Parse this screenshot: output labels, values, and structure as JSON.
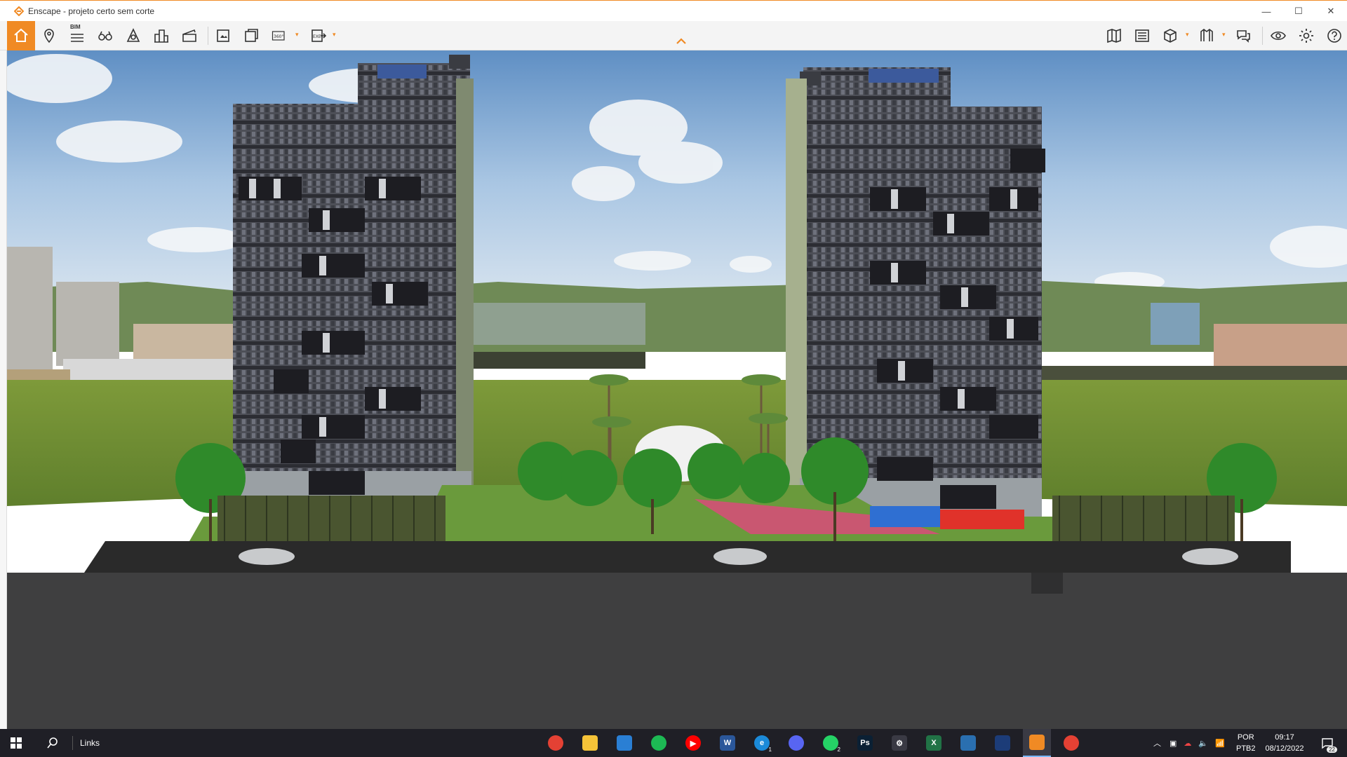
{
  "window": {
    "title": "Enscape - projeto certo sem corte",
    "minimize": "—",
    "maximize": "☐",
    "close": "✕",
    "accent": "#f08a24"
  },
  "toolbar": {
    "bim_label": "BIM",
    "pano_label": "360°",
    "exe_label": "EXE",
    "left_tools": [
      "home-icon",
      "location-icon",
      "bim-icon",
      "views-icon",
      "atmosphere-icon",
      "buildings-icon",
      "video-editor-icon",
      "screenshot-icon",
      "batch-render-icon",
      "panorama-icon",
      "export-icon"
    ],
    "right_tools": [
      "map-icon",
      "asset-library-icon",
      "material-editor-icon",
      "views-manager-icon",
      "collaboration-icon",
      "visual-settings-icon",
      "settings-icon",
      "help-icon"
    ]
  },
  "taskbar": {
    "links_label": "Links",
    "apps": [
      {
        "name": "chrome",
        "color": "#e44134",
        "label": ""
      },
      {
        "name": "file-explorer",
        "color": "#f5c338",
        "label": ""
      },
      {
        "name": "store",
        "color": "#2a7fd4",
        "label": ""
      },
      {
        "name": "spotify",
        "color": "#1db954",
        "label": ""
      },
      {
        "name": "youtube",
        "color": "#ff0000",
        "label": "▶"
      },
      {
        "name": "word",
        "color": "#2b579a",
        "label": "W"
      },
      {
        "name": "edge",
        "color": "#1b8ad9",
        "label": "e"
      },
      {
        "name": "discord",
        "color": "#5865f2",
        "label": ""
      },
      {
        "name": "whatsapp",
        "color": "#25d366",
        "label": ""
      },
      {
        "name": "photoshop",
        "color": "#0b2034",
        "label": "Ps"
      },
      {
        "name": "settings",
        "color": "#3a3a44",
        "label": "⚙"
      },
      {
        "name": "excel",
        "color": "#217346",
        "label": "X"
      },
      {
        "name": "photos",
        "color": "#2a6fb0",
        "label": ""
      },
      {
        "name": "sketchup",
        "color": "#1c3c78",
        "label": ""
      },
      {
        "name": "enscape",
        "color": "#f08a24",
        "label": ""
      },
      {
        "name": "chrome-profile",
        "color": "#e44134",
        "label": ""
      }
    ],
    "edge_badge": "1",
    "whatsapp_badge": "2",
    "language_top": "POR",
    "language_bottom": "PTB2",
    "time": "09:17",
    "date": "08/12/2022",
    "notifications": "22"
  }
}
